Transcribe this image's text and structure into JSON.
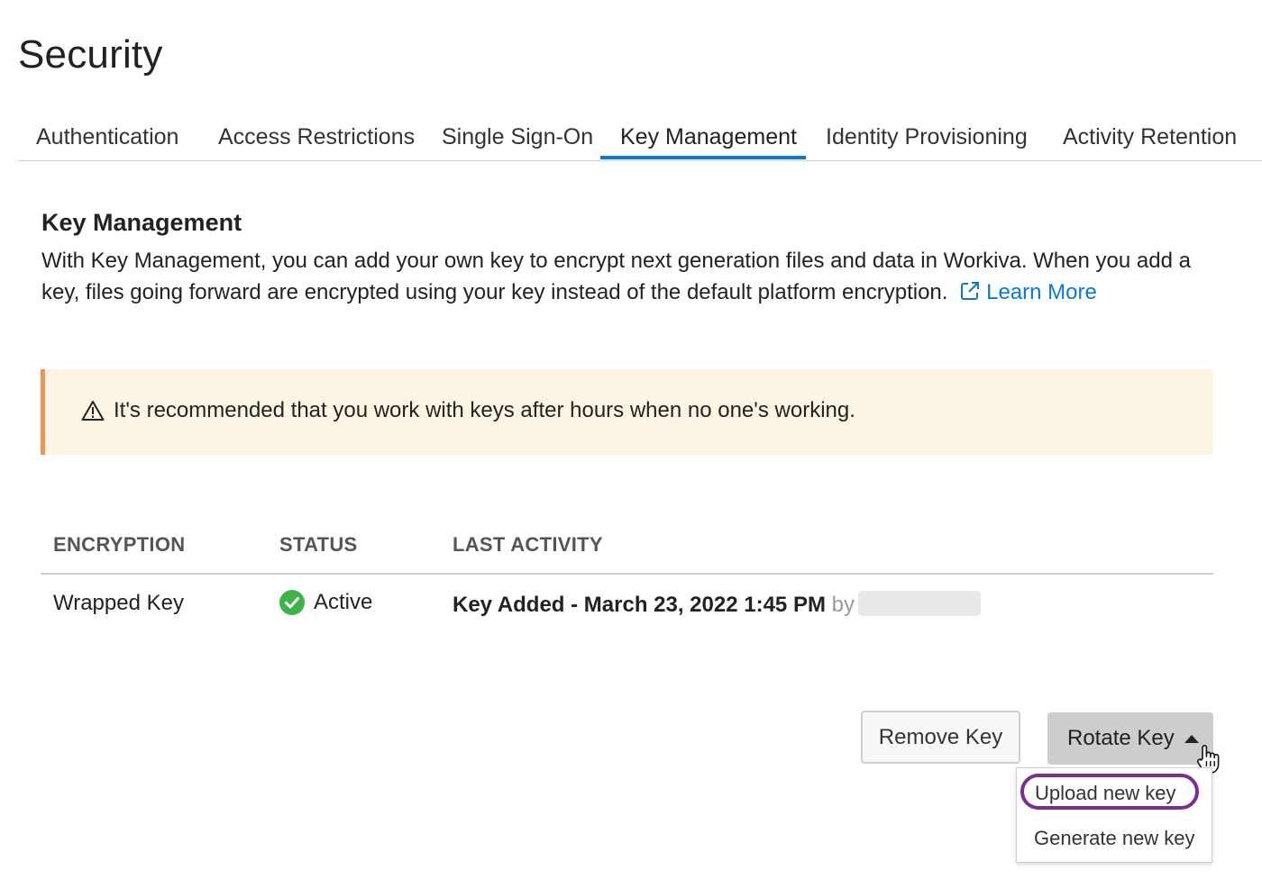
{
  "page": {
    "title": "Security"
  },
  "tabs": [
    {
      "label": "Authentication"
    },
    {
      "label": "Access Restrictions"
    },
    {
      "label": "Single Sign-On"
    },
    {
      "label": "Key Management",
      "active": true
    },
    {
      "label": "Identity Provisioning"
    },
    {
      "label": "Activity Retention"
    }
  ],
  "section": {
    "title": "Key Management",
    "description": "With Key Management, you can add your own key to encrypt next generation files and data in Workiva. When you add a key, files going forward are encrypted using your key instead of the default platform encryption.",
    "learn_more": "Learn More",
    "learn_more_icon": "external-link-icon"
  },
  "alert": {
    "icon": "warning-icon",
    "text": "It's recommended that you work with keys after hours when no one's working.",
    "background": "#fdf5e4",
    "accent": "#f0925a"
  },
  "table": {
    "headers": {
      "encryption": "ENCRYPTION",
      "status": "STATUS",
      "last_activity": "LAST ACTIVITY"
    },
    "row": {
      "encryption": "Wrapped Key",
      "status": "Active",
      "status_icon": "check-circle-icon",
      "status_color": "#3cb44a",
      "activity": "Key Added - March 23, 2022 1:45 PM",
      "activity_by": "by"
    }
  },
  "actions": {
    "remove_label": "Remove Key",
    "rotate_label": "Rotate Key",
    "menu": {
      "upload": "Upload new key",
      "generate": "Generate new key"
    }
  },
  "colors": {
    "accent": "#0a79d3",
    "highlight": "#7b2e8f"
  }
}
